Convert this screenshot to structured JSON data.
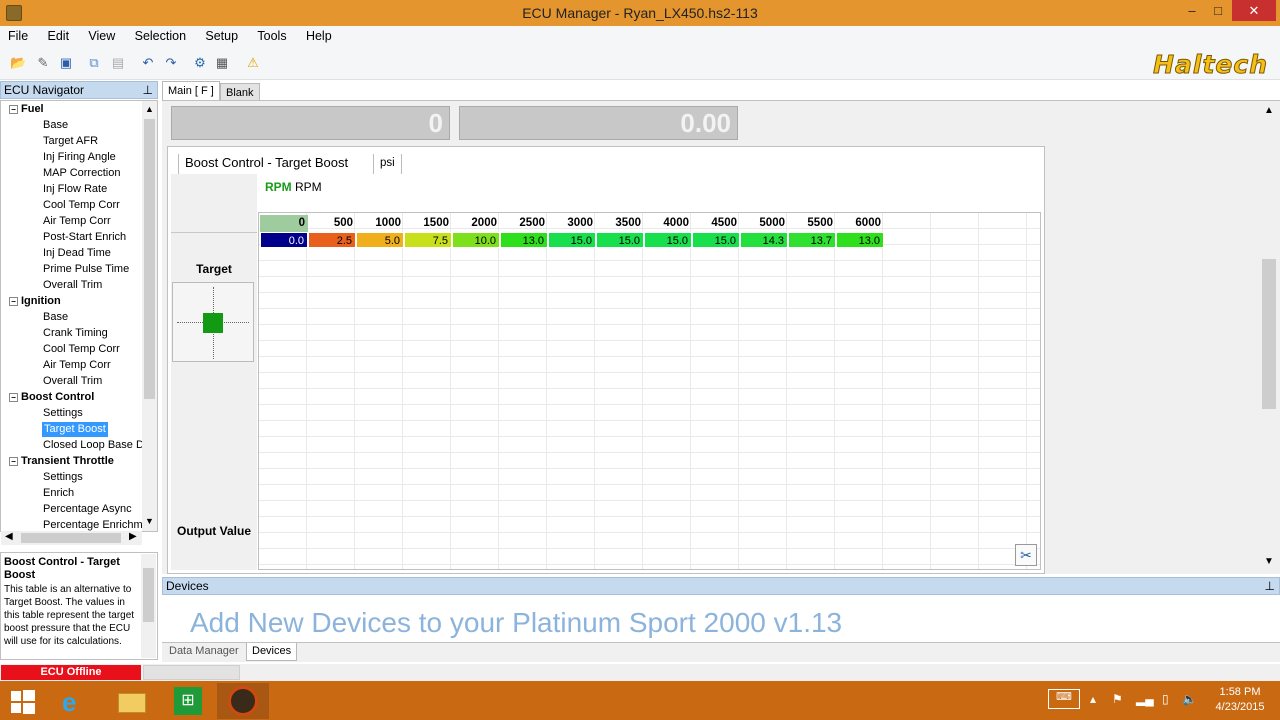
{
  "window": {
    "title": "ECU Manager - Ryan_LX450.hs2-113",
    "minimize": "–",
    "maximize": "□",
    "close": "✕"
  },
  "menu": [
    "File",
    "Edit",
    "View",
    "Selection",
    "Setup",
    "Tools",
    "Help"
  ],
  "brand": {
    "logo_text": "Haltech",
    "accent": "#f6bf18",
    "titlebar": "#e4952e"
  },
  "toolbar": {
    "icons": [
      "open-folder-icon",
      "wand-icon",
      "save-icon",
      "copy-icon",
      "paste-icon",
      "undo-icon",
      "redo-icon",
      "gear-icon",
      "grid-icon",
      "warning-icon"
    ]
  },
  "navigator": {
    "title": "ECU Navigator",
    "pin": "⊥",
    "groups": [
      {
        "label": "Fuel",
        "items": [
          "Base",
          "Target AFR",
          "Inj Firing Angle",
          "MAP Correction",
          "Inj Flow Rate",
          "Cool Temp Corr",
          "Air Temp Corr",
          "Post-Start Enrich",
          "Inj Dead Time",
          "Prime Pulse Time",
          "Overall Trim"
        ]
      },
      {
        "label": "Ignition",
        "items": [
          "Base",
          "Crank Timing",
          "Cool Temp Corr",
          "Air Temp Corr",
          "Overall Trim"
        ]
      },
      {
        "label": "Boost Control",
        "items": [
          "Settings",
          "Target Boost",
          "Closed Loop Base D"
        ]
      },
      {
        "label": "Transient Throttle",
        "items": [
          "Settings",
          "Enrich",
          "Percentage Async",
          "Percentage Enrichm"
        ]
      }
    ],
    "selected": "Target Boost"
  },
  "help": {
    "title": "Boost Control - Target Boost",
    "body": "This table is an alternative to Target Boost. The values in this table represent the target boost pressure that the ECU will use for its calculations."
  },
  "status": {
    "ecu": "ECU Offline"
  },
  "tabs": {
    "main": "Main [ F ]",
    "blank": "Blank"
  },
  "gauges": [
    "0",
    "0.00"
  ],
  "table": {
    "title": "Boost Control - Target Boost",
    "unit": "psi",
    "axis_label_bold": "RPM",
    "axis_label": "RPM",
    "row_label": "Target",
    "output_label": "Output Value",
    "rpm": [
      "0",
      "500",
      "1000",
      "1500",
      "2000",
      "2500",
      "3000",
      "3500",
      "4000",
      "4500",
      "5000",
      "5500",
      "6000"
    ],
    "values": [
      "0.0",
      "2.5",
      "5.0",
      "7.5",
      "10.0",
      "13.0",
      "15.0",
      "15.0",
      "15.0",
      "15.0",
      "14.3",
      "13.7",
      "13.0"
    ],
    "colors": [
      "#00008b",
      "#e8601c",
      "#f0b01e",
      "#c8e01c",
      "#7ee01c",
      "#2ee01c",
      "#18e04c",
      "#18e04c",
      "#18e04c",
      "#18e04c",
      "#24e03c",
      "#30e030",
      "#2ee01c"
    ]
  },
  "devices": {
    "header": "Devices",
    "message": "Add New Devices to your Platinum Sport 2000 v1.13"
  },
  "bottom_tabs": [
    "Data Manager",
    "Devices"
  ],
  "taskbar": {
    "time": "1:58 PM",
    "date": "4/23/2015",
    "apps": [
      "windows-start-icon",
      "ie-icon",
      "explorer-icon",
      "store-icon",
      "haltech-app-icon"
    ]
  }
}
